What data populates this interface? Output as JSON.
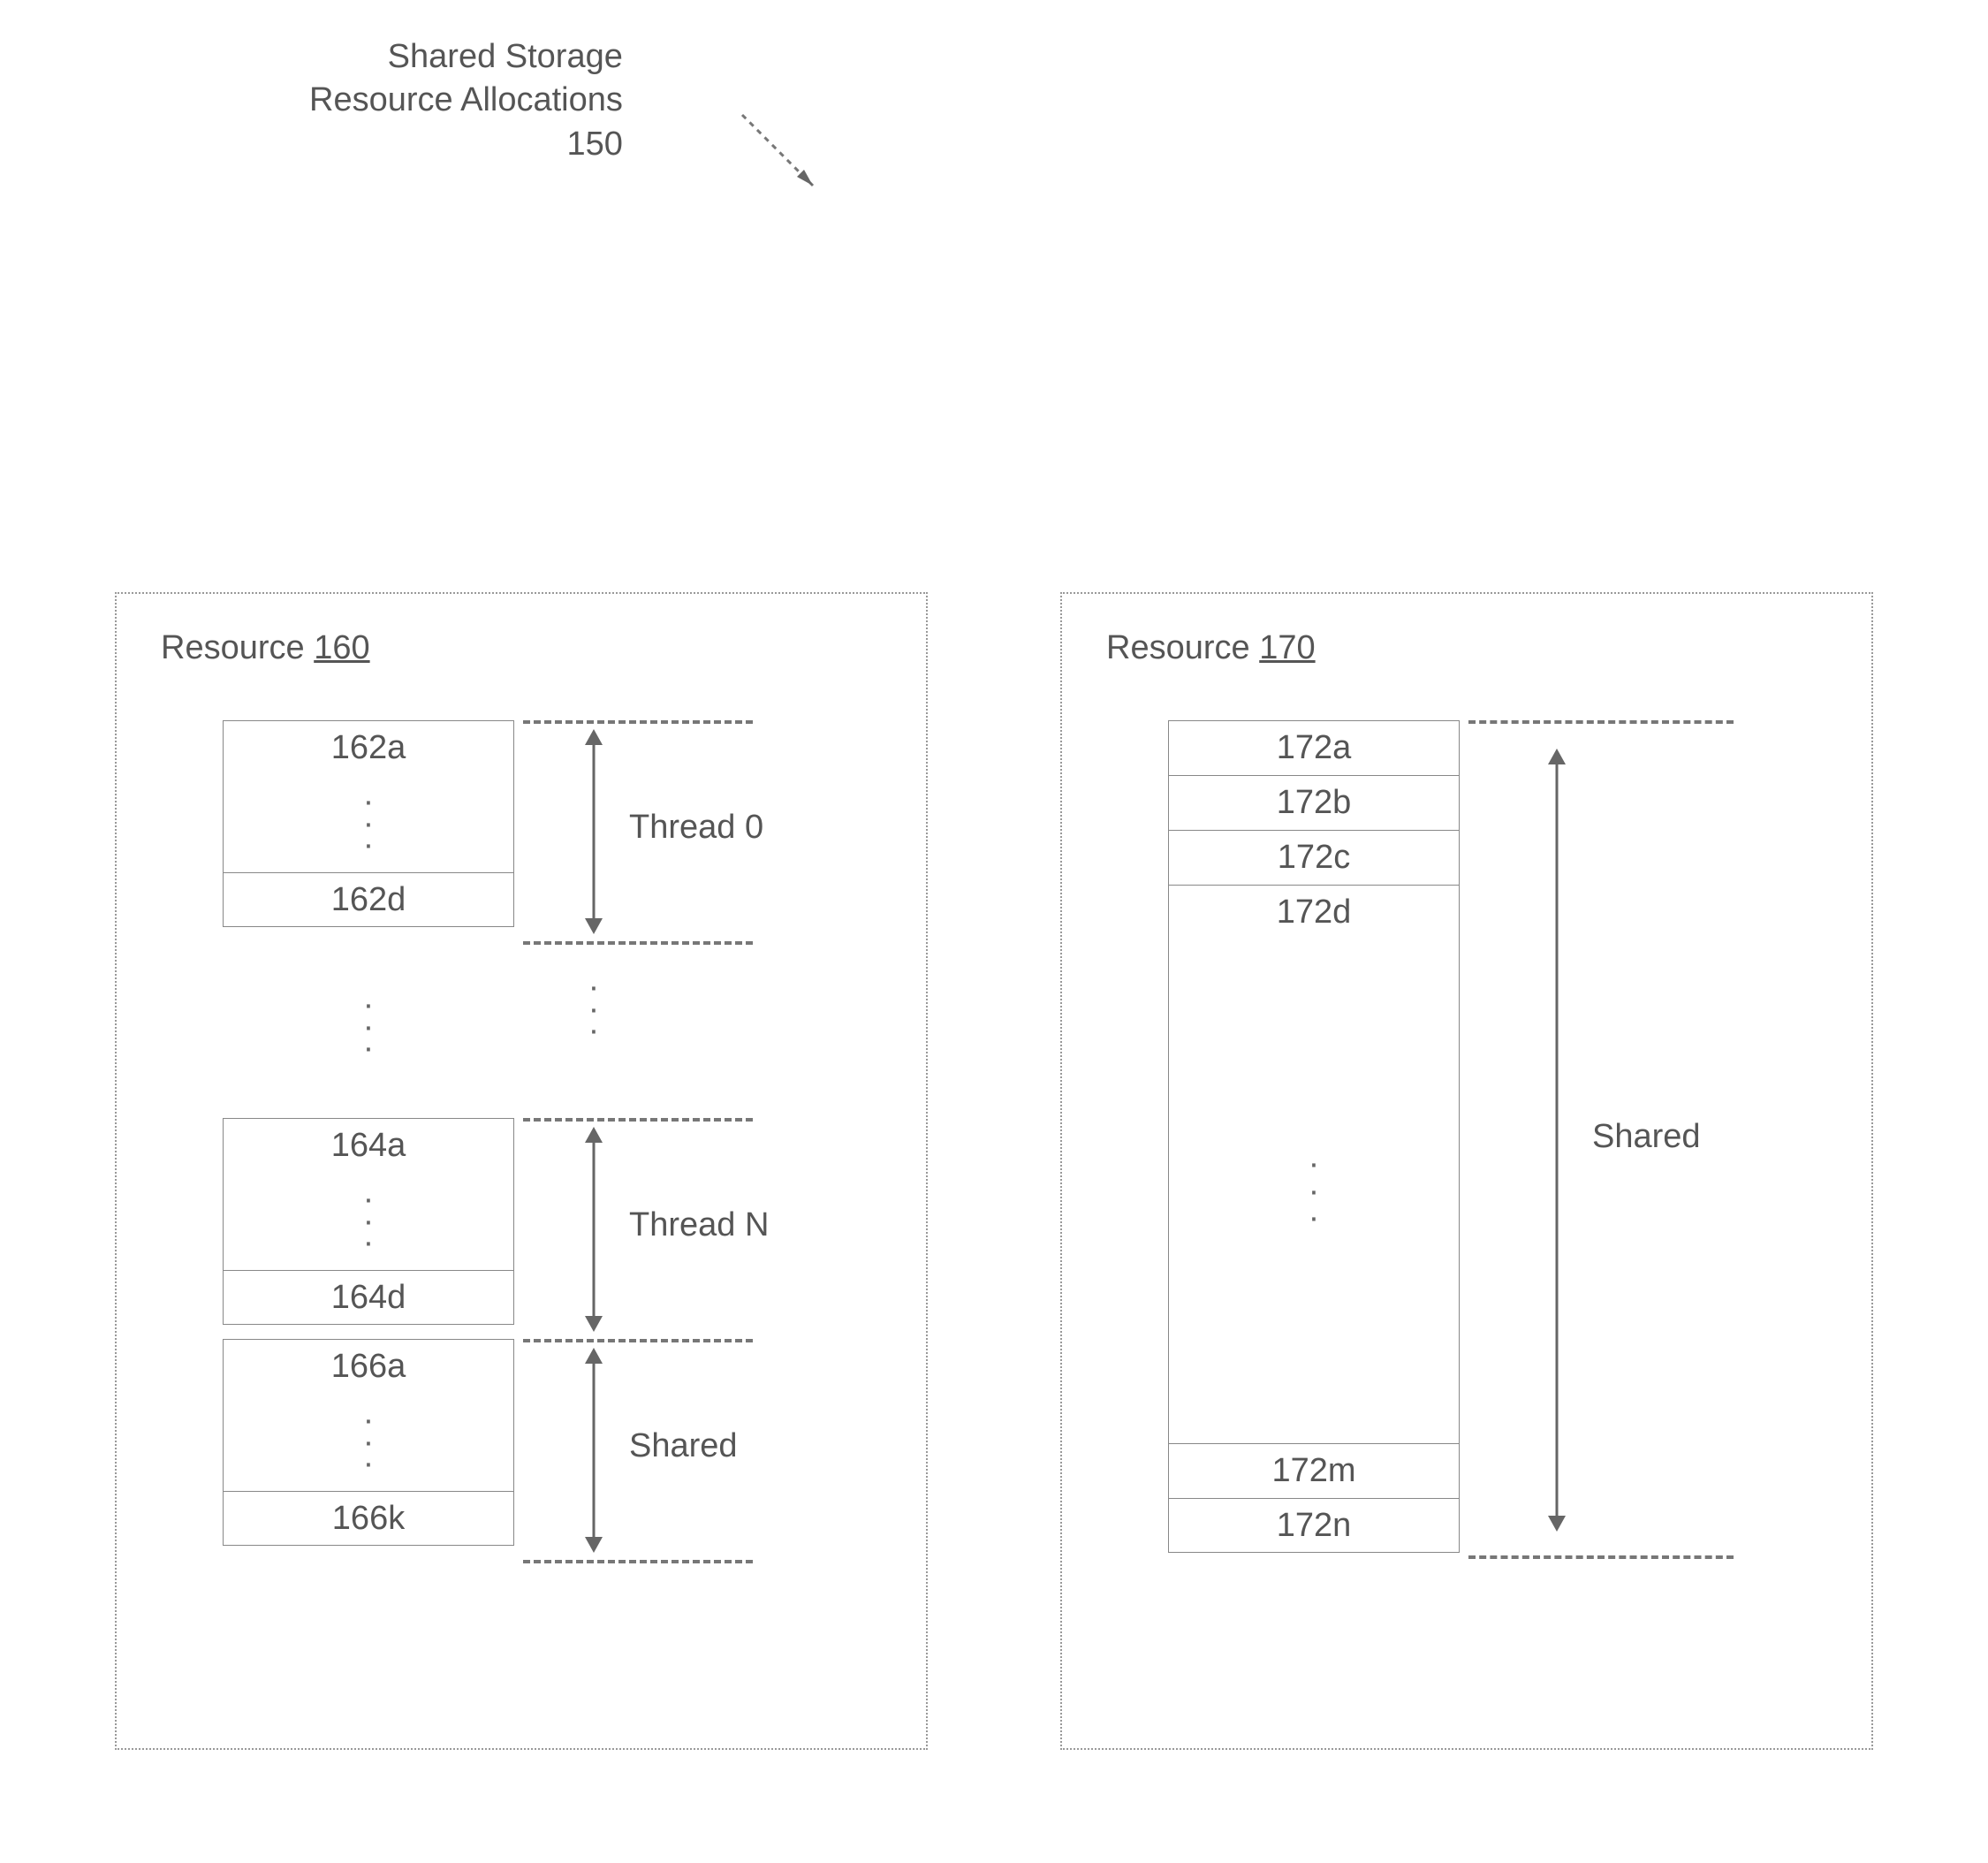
{
  "title": {
    "line1": "Shared Storage",
    "line2": "Resource Allocations",
    "ref": "150"
  },
  "resource160": {
    "label_prefix": "Resource",
    "label_ref": "160",
    "cells": {
      "t0_first": "162a",
      "t0_last": "162d",
      "tn_first": "164a",
      "tn_last": "164d",
      "sh_first": "166a",
      "sh_last": "166k"
    },
    "ranges": {
      "thread0": "Thread 0",
      "threadN": "Thread N",
      "shared": "Shared"
    }
  },
  "resource170": {
    "label_prefix": "Resource",
    "label_ref": "170",
    "cells": {
      "c1": "172a",
      "c2": "172b",
      "c3": "172c",
      "c4": "172d",
      "cm": "172m",
      "cn": "172n"
    },
    "range_label": "Shared"
  }
}
